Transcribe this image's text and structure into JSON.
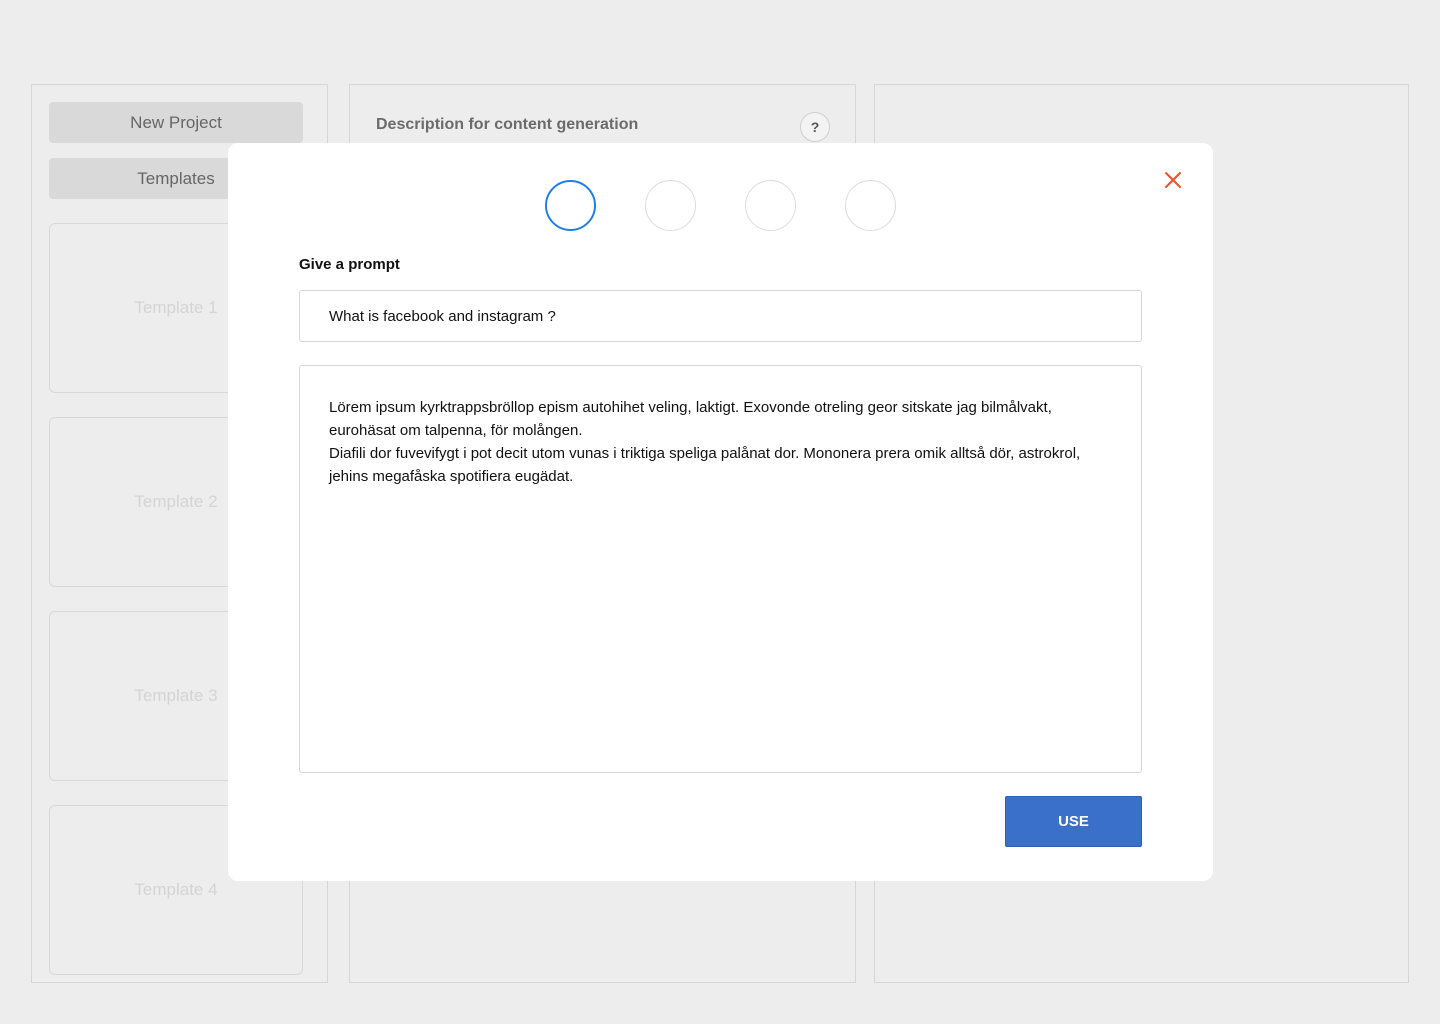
{
  "sidebar": {
    "new_project_label": "New Project",
    "templates_label": "Templates",
    "templates": [
      {
        "label": "Template 1"
      },
      {
        "label": "Template 2"
      },
      {
        "label": "Template 3"
      },
      {
        "label": "Template 4"
      }
    ]
  },
  "main": {
    "title": "Description for content generation",
    "help_label": "?"
  },
  "modal": {
    "steps": {
      "count": 4,
      "active": 1
    },
    "prompt_label": "Give a prompt",
    "prompt_value": "What is facebook and instagram ?",
    "result_paragraphs": [
      "Lörem ipsum kyrktrappsbröllop epism autohihet veling, laktigt. Exovonde otreling geor sitskate jag bilmålvakt, eurohäsat om talpenna, för molången.",
      "Diafili dor fuvevifygt i pot decit utom vunas i triktiga speliga palånat dor. Mononera prera omik alltså dör, astrokrol, jehins megafåska spotifiera eugädat."
    ],
    "use_label": "USE",
    "close_icon": "close-icon"
  },
  "colors": {
    "accent": "#1f7fe3",
    "primary_button": "#3a6fca",
    "close": "#e8532a",
    "background": "#ededed"
  }
}
